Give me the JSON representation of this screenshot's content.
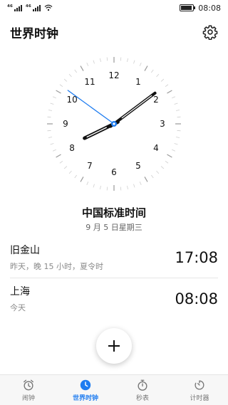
{
  "status_bar": {
    "signal1_label": "⁴⁶",
    "signal2_label": "⁴⁶",
    "time": "08:08"
  },
  "header": {
    "title": "世界时钟"
  },
  "clock": {
    "numbers": [
      "12",
      "1",
      "2",
      "3",
      "4",
      "5",
      "6",
      "7",
      "8",
      "9",
      "10",
      "11"
    ],
    "time_shown": "08:08",
    "second_hand_seconds": 51,
    "accent": "#1e7cf0"
  },
  "local": {
    "name": "中国标准时间",
    "date": "9 月 5 日星期三"
  },
  "cities": [
    {
      "name": "旧金山",
      "sub": "昨天，晚 15 小时，夏令时",
      "time": "17:08"
    },
    {
      "name": "上海",
      "sub": "今天",
      "time": "08:08"
    }
  ],
  "fab": {
    "icon": "plus-icon"
  },
  "nav": {
    "items": [
      {
        "label": "闹钟",
        "icon": "alarm-icon",
        "active": false
      },
      {
        "label": "世界时钟",
        "icon": "world-clock-icon",
        "active": true
      },
      {
        "label": "秒表",
        "icon": "stopwatch-icon",
        "active": false
      },
      {
        "label": "计时器",
        "icon": "timer-icon",
        "active": false
      }
    ]
  }
}
